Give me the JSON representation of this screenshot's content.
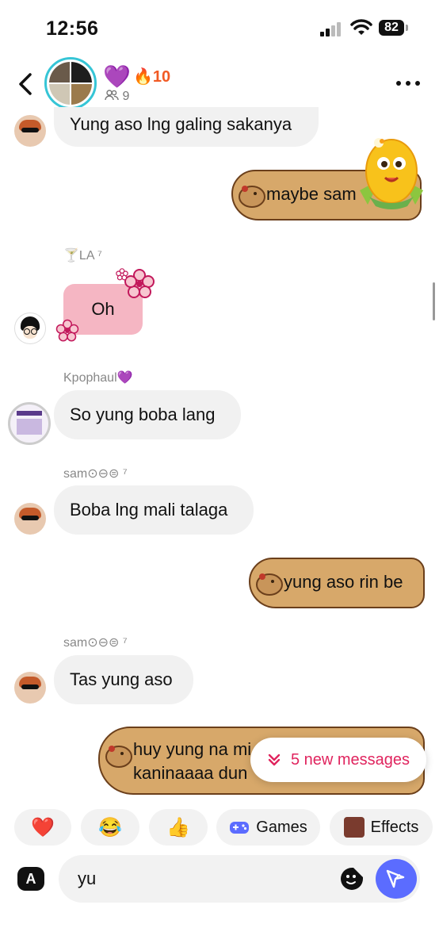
{
  "status_bar": {
    "time": "12:56",
    "battery": "82"
  },
  "header": {
    "heart": "💜",
    "streak": "🔥10",
    "member_count": "9"
  },
  "messages": [
    {
      "sender": "",
      "text": "Yung aso lng galing sakanya",
      "direction": "in"
    },
    {
      "sender": "",
      "text": "maybe sam",
      "direction": "out"
    },
    {
      "sender": "🍸LA ⁷",
      "text": "Oh",
      "direction": "in"
    },
    {
      "sender": "Kpophaul💜",
      "text": "So yung boba lang",
      "direction": "in"
    },
    {
      "sender": "sam⊙⊖⊜ ⁷",
      "text": "Boba lng mali talaga",
      "direction": "in"
    },
    {
      "sender": "",
      "text": "yung aso rin be",
      "direction": "out"
    },
    {
      "sender": "sam⊙⊖⊜ ⁷",
      "text": "Tas yung aso",
      "direction": "in"
    },
    {
      "sender": "",
      "text_line1": "huy yung na mi",
      "text_line2": "kaninaaaa dun",
      "direction": "out"
    }
  ],
  "new_messages_label": "5 new messages",
  "quick_bar": {
    "heart": "❤️",
    "laugh": "😂",
    "thumbs": "👍",
    "games": "Games",
    "effects": "Effects"
  },
  "composer": {
    "value": "yu"
  },
  "colors": {
    "accent": "#e0245e",
    "send": "#5b6cff",
    "ring": "#36c5d6",
    "capybara": "#d7a86a"
  }
}
